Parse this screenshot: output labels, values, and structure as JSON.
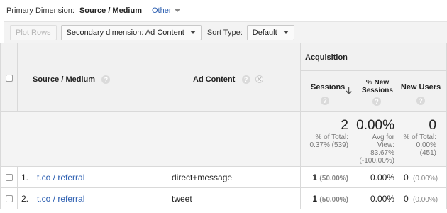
{
  "primary_dimension": {
    "label": "Primary Dimension:",
    "value": "Source / Medium",
    "other": "Other"
  },
  "toolbar": {
    "plot_rows": "Plot Rows",
    "secondary_dimension": "Secondary dimension: Ad Content",
    "sort_type_label": "Sort Type:",
    "sort_type_value": "Default"
  },
  "headers": {
    "source_medium": "Source / Medium",
    "ad_content": "Ad Content",
    "acquisition": "Acquisition",
    "sessions": "Sessions",
    "pct_new_sessions_line1": "% New",
    "pct_new_sessions_line2": "Sessions",
    "new_users": "New Users",
    "help_glyph": "?"
  },
  "totals": {
    "sessions": "2",
    "sessions_sub1": "% of Total:",
    "sessions_sub2": "0.37% (539)",
    "pct_new": "0.00%",
    "pct_new_sub1": "Avg for",
    "pct_new_sub2": "View:",
    "pct_new_sub3": "83.67%",
    "pct_new_sub4": "(-100.00%)",
    "new_users": "0",
    "new_users_sub1": "% of Total:",
    "new_users_sub2": "0.00%",
    "new_users_sub3": "(451)"
  },
  "rows": [
    {
      "index": "1.",
      "source": "t.co / referral",
      "ad_content": "direct+message",
      "sessions": "1",
      "sessions_pct": "(50.00%)",
      "pct_new": "0.00%",
      "new_users": "0",
      "new_users_pct": "(0.00%)"
    },
    {
      "index": "2.",
      "source": "t.co / referral",
      "ad_content": "tweet",
      "sessions": "1",
      "sessions_pct": "(50.00%)",
      "pct_new": "0.00%",
      "new_users": "0",
      "new_users_pct": "(0.00%)"
    }
  ]
}
